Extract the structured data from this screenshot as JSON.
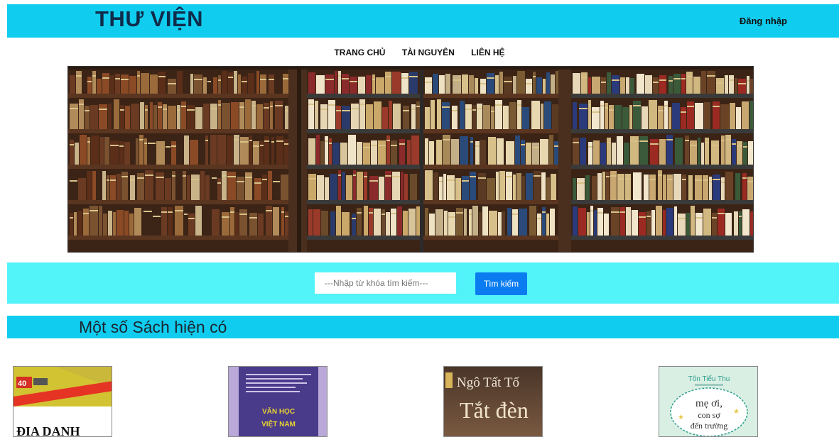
{
  "header": {
    "logo": "THƯ VIỆN",
    "login_label": "Đăng nhập"
  },
  "nav": {
    "items": [
      "TRANG CHỦ",
      "TÀI NGUYÊN",
      "LIÊN HỆ"
    ]
  },
  "search": {
    "placeholder": "---Nhập từ khóa tìm kiếm---",
    "button_label": "Tìm kiếm"
  },
  "section": {
    "title": "Một số Sách hiện có"
  },
  "books": [
    {
      "cover_text": "ĐỊA DANH",
      "cover_badge": "40"
    },
    {
      "cover_text_line1": "VĂN HỌC",
      "cover_text_line2": "VIỆT NAM"
    },
    {
      "author": "Ngô Tất Tố",
      "cover_text": "Tắt đèn"
    },
    {
      "author": "Tôn Tiểu Thu",
      "cover_text_line1": "mẹ ơi,",
      "cover_text_line2": "con sợ",
      "cover_text_line3": "đến trường"
    }
  ],
  "colors": {
    "header_bg": "#10cdef",
    "search_band_bg": "#53f3fa",
    "button_bg": "#0b7cf0"
  }
}
